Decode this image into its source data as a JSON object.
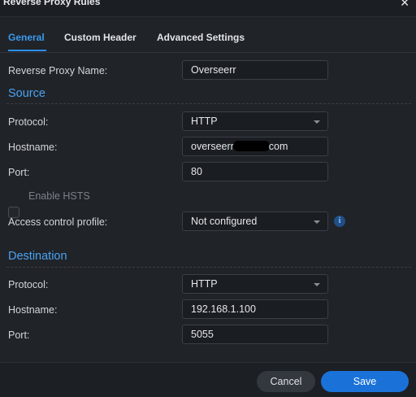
{
  "dialog": {
    "title": "Reverse Proxy Rules",
    "close_icon": "close-icon"
  },
  "tabs": [
    {
      "label": "General",
      "active": true
    },
    {
      "label": "Custom Header",
      "active": false
    },
    {
      "label": "Advanced Settings",
      "active": false
    }
  ],
  "general": {
    "name_label": "Reverse Proxy Name:",
    "name_value": "Overseerr"
  },
  "source": {
    "title": "Source",
    "protocol_label": "Protocol:",
    "protocol_value": "HTTP",
    "hostname_label": "Hostname:",
    "hostname_prefix": "overseerr",
    "hostname_suffix": "com",
    "port_label": "Port:",
    "port_value": "80",
    "hsts_label": "Enable HSTS",
    "hsts_checked": false,
    "acp_label": "Access control profile:",
    "acp_value": "Not configured",
    "info_icon_glyph": "i"
  },
  "destination": {
    "title": "Destination",
    "protocol_label": "Protocol:",
    "protocol_value": "HTTP",
    "hostname_label": "Hostname:",
    "hostname_value": "192.168.1.100",
    "port_label": "Port:",
    "port_value": "5055"
  },
  "footer": {
    "cancel_label": "Cancel",
    "save_label": "Save"
  },
  "colors": {
    "accent": "#2c8ff0",
    "primary_button": "#1a72d8",
    "background": "#202328"
  }
}
